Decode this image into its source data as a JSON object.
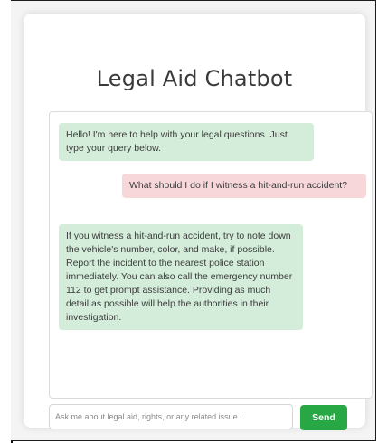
{
  "app": {
    "title": "Legal Aid Chatbot"
  },
  "messages": [
    {
      "sender": "bot",
      "text": "Hello! I'm here to help with your legal questions. Just type your query below."
    },
    {
      "sender": "user",
      "text": "What should I do if I witness a hit-and-run accident?"
    },
    {
      "sender": "bot",
      "text": "If you witness a hit-and-run accident, try to note down the vehicle's number, color, and make, if possible. Report the incident to the nearest police station immediately. You can also call the emergency number 112 to get prompt assistance. Providing as much detail as possible will help the authorities in their investigation."
    }
  ],
  "composer": {
    "placeholder": "Ask me about legal aid, rights, or any related issue...",
    "value": "",
    "send_label": "Send"
  },
  "colors": {
    "bot_bubble": "#d4edda",
    "user_bubble": "#f8d7da",
    "send_button": "#28a745"
  }
}
